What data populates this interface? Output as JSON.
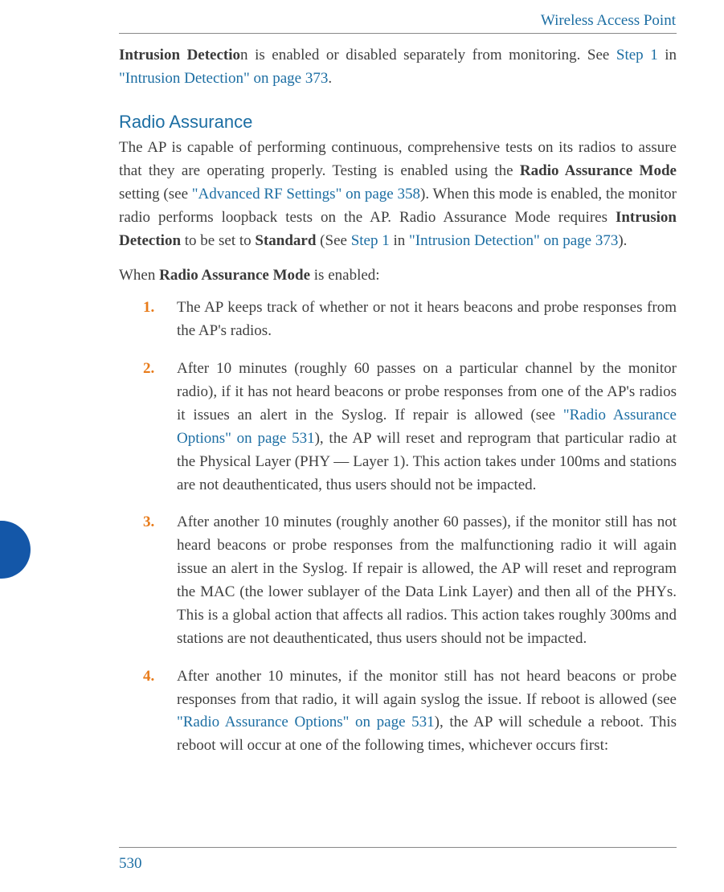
{
  "header": {
    "title": "Wireless Access Point"
  },
  "footer": {
    "page_number": "530"
  },
  "intro": {
    "bold_lead": "Intrusion Detectio",
    "after_bold": "n is enabled or disabled separately from monitoring. See ",
    "link1": "Step 1",
    "mid": " in ",
    "link2": "\"Intrusion Detection\" on page 373",
    "tail": "."
  },
  "section": {
    "heading": "Radio Assurance"
  },
  "para2": {
    "t1": "The AP is capable of performing continuous, comprehensive tests on its radios to assure that they are operating properly. Testing is enabled using the ",
    "b1": "Radio Assurance Mode",
    "t2": " setting (see ",
    "l1": "\"Advanced RF Settings\" on page 358",
    "t3": "). When this mode is enabled, the monitor radio performs loopback tests on the AP. Radio Assurance Mode requires ",
    "b2": "Intrusion Detection",
    "t4": " to be set to ",
    "b3": "Standard",
    "t5": " (See ",
    "l2": "Step 1",
    "t6": " in ",
    "l3": "\"Intrusion Detection\" on page 373",
    "t7": ")."
  },
  "para3": {
    "t1": "When ",
    "b1": "Radio Assurance Mode",
    "t2": " is enabled:"
  },
  "list": {
    "n1": "1.",
    "i1": "The AP keeps track of whether or not it hears beacons and probe responses from the AP's radios.",
    "n2": "2.",
    "i2a": "After 10 minutes (roughly 60 passes on a particular channel by the monitor radio), if it has not heard beacons or probe responses from one of the AP's radios it issues an alert in the Syslog. If repair is allowed (see ",
    "i2l": "\"Radio Assurance Options\" on page 531",
    "i2b": "), the AP will reset and reprogram that particular radio at the Physical Layer (PHY — Layer 1). This action takes under 100ms and stations are not deauthenticated, thus users should not be impacted.",
    "n3": "3.",
    "i3": "After another 10 minutes (roughly another 60 passes), if the monitor still has not heard beacons or probe responses from the malfunctioning radio it will again issue an alert in the Syslog. If repair is allowed, the AP will reset and reprogram the MAC (the lower sublayer of the Data Link Layer) and then all of the PHYs. This is a global action that affects all radios. This action takes roughly 300ms and stations are not deauthenticated, thus users should not be impacted.",
    "n4": "4.",
    "i4a": "After another 10 minutes, if the monitor still has not heard beacons or probe responses from that radio, it will again syslog the issue. If reboot is allowed (see ",
    "i4l": "\"Radio Assurance Options\" on page 531",
    "i4b": "), the AP will schedule a reboot. This reboot will occur at one of the following times, whichever occurs first:"
  }
}
